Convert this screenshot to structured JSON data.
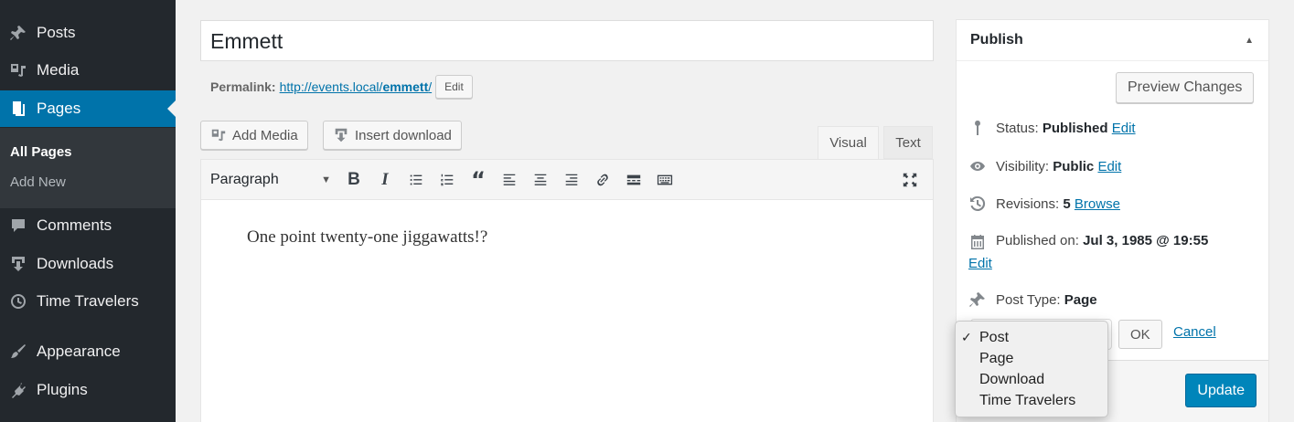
{
  "sidebar": {
    "items": [
      {
        "label": "Posts",
        "icon": "pin-icon"
      },
      {
        "label": "Media",
        "icon": "media-icon"
      },
      {
        "label": "Pages",
        "icon": "pages-icon"
      },
      {
        "label": "Comments",
        "icon": "comments-icon"
      },
      {
        "label": "Downloads",
        "icon": "download-icon"
      },
      {
        "label": "Time Travelers",
        "icon": "clock-icon"
      },
      {
        "label": "Appearance",
        "icon": "paintbrush-icon"
      },
      {
        "label": "Plugins",
        "icon": "plugin-icon"
      }
    ],
    "submenu": [
      {
        "label": "All Pages"
      },
      {
        "label": "Add New"
      }
    ],
    "accent": "#0073aa"
  },
  "editor": {
    "title": "Emmett",
    "permalink_label": "Permalink:",
    "permalink_base": "http://events.local/",
    "permalink_slug": "emmett",
    "permalink_tail": "/",
    "permalink_edit": "Edit",
    "add_media": "Add Media",
    "insert_download": "Insert download",
    "tab_visual": "Visual",
    "tab_text": "Text",
    "format": "Paragraph",
    "content": "One point twenty-one jiggawatts!?"
  },
  "toolbar": {
    "bold": "B",
    "italic": "I",
    "blockquote": "“"
  },
  "publish": {
    "title": "Publish",
    "preview": "Preview Changes",
    "status_label": "Status:",
    "status_value": "Published",
    "visibility_label": "Visibility:",
    "visibility_value": "Public",
    "revisions_label": "Revisions:",
    "revisions_value": "5",
    "browse": "Browse",
    "published_label": "Published on:",
    "published_value": "Jul 3, 1985 @ 19:55",
    "edit": "Edit",
    "post_type_label": "Post Type:",
    "post_type_value": "Page",
    "ok": "OK",
    "cancel": "Cancel",
    "update": "Update"
  },
  "post_type_dropdown": {
    "options": [
      {
        "label": "Post",
        "check": "✓"
      },
      {
        "label": "Page",
        "check": ""
      },
      {
        "label": "Download",
        "check": ""
      },
      {
        "label": "Time Travelers",
        "check": ""
      }
    ]
  }
}
